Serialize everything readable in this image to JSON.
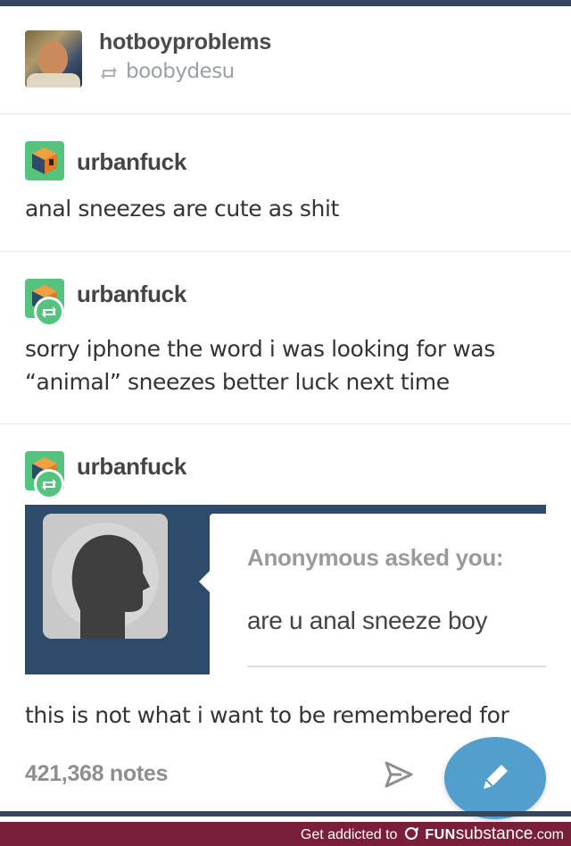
{
  "header": {
    "blog_name": "hotboyproblems",
    "reblogged_from": "boobydesu"
  },
  "posts": [
    {
      "username": "urbanfuck",
      "text_lines": [
        "anal sneezes are cute as shit"
      ]
    },
    {
      "username": "urbanfuck",
      "text_lines": [
        "sorry iphone the word i was looking for was",
        "“animal” sneezes better luck next time"
      ]
    },
    {
      "username": "urbanfuck",
      "ask": {
        "asked_label": "Anonymous asked you:",
        "question": "are u anal sneeze boy"
      },
      "answer": "this is not what i want to be remembered for"
    }
  ],
  "footer_actions": {
    "notes": "421,368 notes"
  },
  "colors": {
    "accent": "#529ecc",
    "ask_background": "#2f4b6b",
    "reblog_badge": "#55c37d"
  },
  "icons": [
    "reblog-icon",
    "share-icon",
    "pencil-icon"
  ],
  "watermark": {
    "prefix": "Get addicted to",
    "brand_fun": "FUN",
    "brand_sub": "substance",
    "suffix": ".com"
  }
}
